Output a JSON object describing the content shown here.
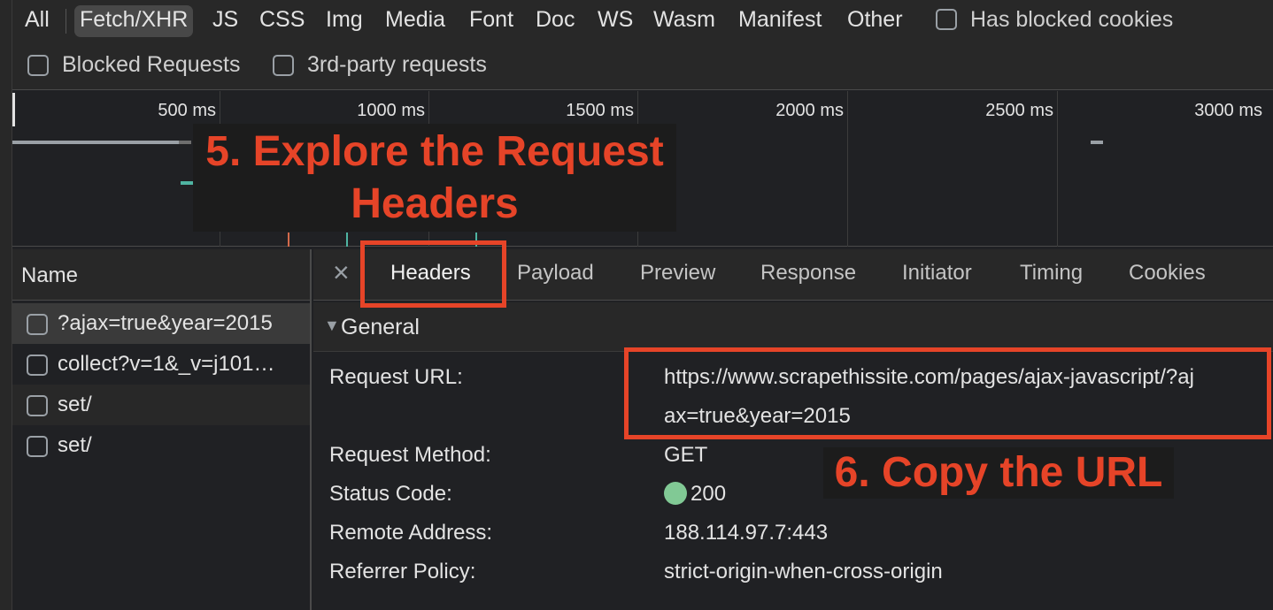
{
  "filters": {
    "types": [
      "All",
      "Fetch/XHR",
      "JS",
      "CSS",
      "Img",
      "Media",
      "Font",
      "Doc",
      "WS",
      "Wasm",
      "Manifest",
      "Other"
    ],
    "active": "Fetch/XHR",
    "has_blocked_cookies": "Has blocked cookies",
    "blocked_requests": "Blocked Requests",
    "third_party": "3rd-party requests"
  },
  "overview": {
    "ticks": [
      "500 ms",
      "1000 ms",
      "1500 ms",
      "2000 ms",
      "2500 ms",
      "3000 ms"
    ]
  },
  "annotations": {
    "step5_line1": "5. Explore the Request",
    "step5_line2": "Headers",
    "step6": "6. Copy the URL",
    "color": "#e64428"
  },
  "name_column": {
    "header": "Name",
    "rows": [
      "?ajax=true&year=2015",
      "collect?v=1&_v=j101…",
      "set/",
      "set/"
    ]
  },
  "tabs": {
    "close_icon": "close-icon",
    "items": [
      "Headers",
      "Payload",
      "Preview",
      "Response",
      "Initiator",
      "Timing",
      "Cookies"
    ],
    "active": "Headers"
  },
  "general": {
    "title": "General",
    "request_url_label": "Request URL:",
    "request_url_line1": "https://www.scrapethissite.com/pages/ajax-javascript/?aj",
    "request_url_line2": "ax=true&year=2015",
    "request_method_label": "Request Method:",
    "request_method": "GET",
    "status_code_label": "Status Code:",
    "status_code": "200",
    "status_color": "#81c995",
    "remote_address_label": "Remote Address:",
    "remote_address": "188.114.97.7:443",
    "referrer_policy_label": "Referrer Policy:",
    "referrer_policy": "strict-origin-when-cross-origin"
  }
}
